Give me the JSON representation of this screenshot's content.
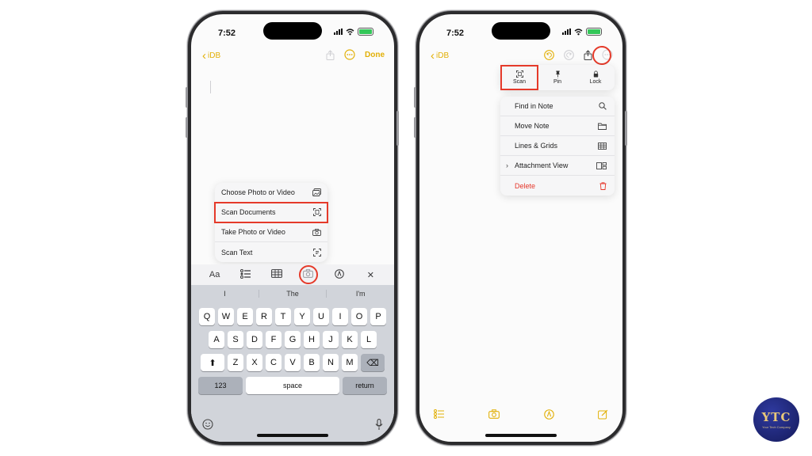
{
  "status": {
    "time": "7:52"
  },
  "left_phone": {
    "back_label": "iDB",
    "done_label": "Done",
    "menu": [
      {
        "label": "Choose Photo or Video",
        "icon": "photo-library-icon"
      },
      {
        "label": "Scan Documents",
        "icon": "scan-document-icon"
      },
      {
        "label": "Take Photo or Video",
        "icon": "camera-icon"
      },
      {
        "label": "Scan Text",
        "icon": "text-scan-icon"
      }
    ],
    "toolbar": {
      "format_label": "Aa"
    },
    "suggestions": [
      "I",
      "The",
      "I'm"
    ],
    "keyboard": {
      "row1": [
        "Q",
        "W",
        "E",
        "R",
        "T",
        "Y",
        "U",
        "I",
        "O",
        "P"
      ],
      "row2": [
        "A",
        "S",
        "D",
        "F",
        "G",
        "H",
        "J",
        "K",
        "L"
      ],
      "row3": [
        "Z",
        "X",
        "C",
        "V",
        "B",
        "N",
        "M"
      ],
      "numbers_label": "123",
      "space_label": "space",
      "return_label": "return"
    }
  },
  "right_phone": {
    "back_label": "iDB",
    "quick_actions": [
      {
        "label": "Scan",
        "icon": "scan-icon"
      },
      {
        "label": "Pin",
        "icon": "pin-icon"
      },
      {
        "label": "Lock",
        "icon": "lock-icon"
      }
    ],
    "menu": [
      {
        "label": "Find in Note",
        "icon": "magnifier-icon"
      },
      {
        "label": "Move Note",
        "icon": "folder-icon"
      },
      {
        "label": "Lines & Grids",
        "icon": "grid-icon"
      },
      {
        "label": "Attachment View",
        "icon": "attachment-view-icon"
      },
      {
        "label": "Delete",
        "icon": "trash-icon"
      }
    ]
  },
  "colors": {
    "accent": "#e2b007",
    "highlight": "#e53a2a",
    "delete": "#e5372b"
  },
  "logo": {
    "text": "YTC",
    "tagline": "Your Tech Company"
  }
}
